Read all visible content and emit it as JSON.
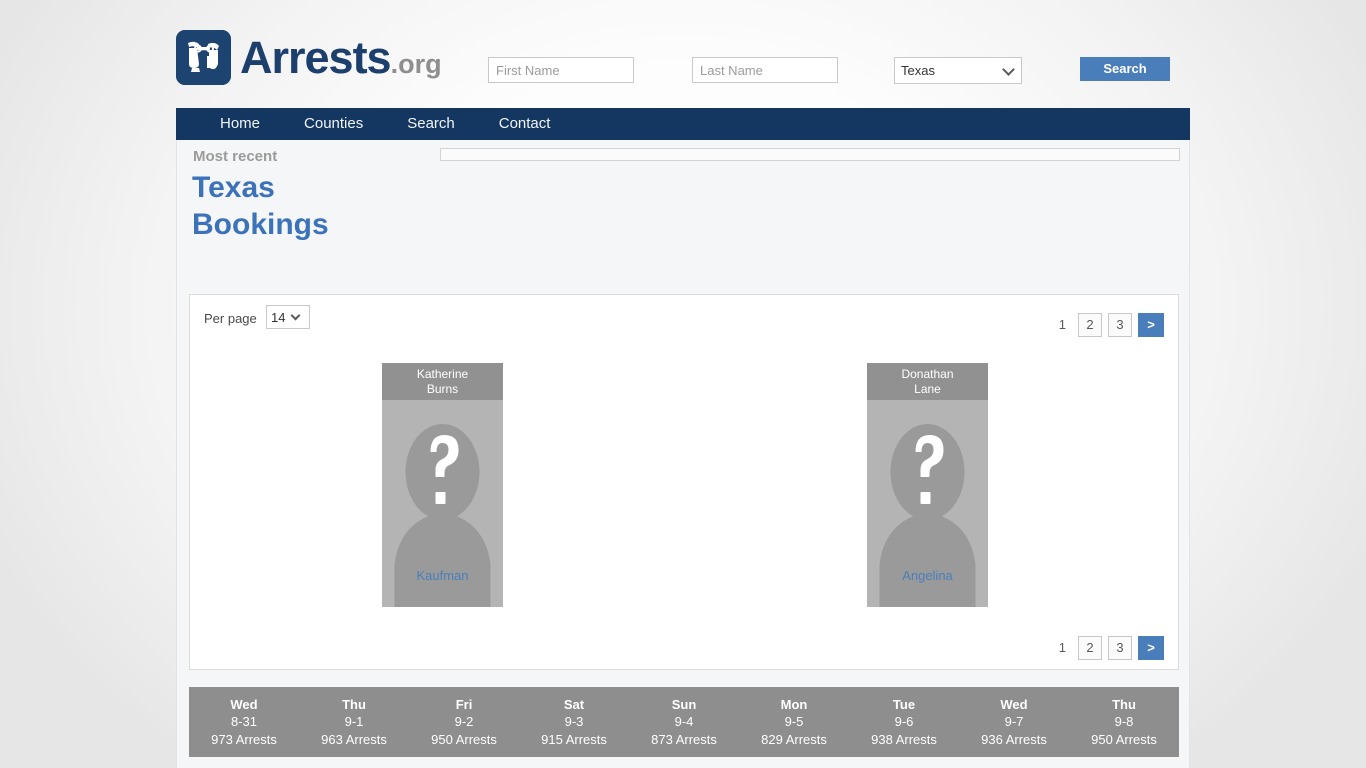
{
  "site": {
    "logo_text": "Arrests",
    "logo_suffix": ".org",
    "logo_icon": "handcuffs-icon"
  },
  "search": {
    "first_name_placeholder": "First Name",
    "first_name_value": "",
    "last_name_placeholder": "Last Name",
    "last_name_value": "",
    "state_selected": "Texas",
    "state_options": [
      "Texas"
    ],
    "search_label": "Search"
  },
  "nav": {
    "items": [
      {
        "label": "Home"
      },
      {
        "label": "Counties"
      },
      {
        "label": "Search"
      },
      {
        "label": "Contact"
      }
    ]
  },
  "heading": {
    "eyebrow": "Most recent",
    "title_line1": "Texas",
    "title_line2": "Bookings"
  },
  "toolbar": {
    "per_page_label": "Per page",
    "per_page_value": "14",
    "per_page_options": [
      "14"
    ]
  },
  "pagination": {
    "current": "1",
    "pages": [
      "2",
      "3"
    ],
    "next_label": ">"
  },
  "results": {
    "cards": [
      {
        "first_name": "Katherine",
        "last_name": "Burns",
        "county": "Kaufman",
        "photo": "no-photo-silhouette"
      },
      {
        "first_name": "Donathan",
        "last_name": "Lane",
        "county": "Angelina",
        "photo": "no-photo-silhouette"
      }
    ]
  },
  "calendar": {
    "days": [
      {
        "dow": "Wed",
        "date": "8-31",
        "count": "973 Arrests"
      },
      {
        "dow": "Thu",
        "date": "9-1",
        "count": "963 Arrests"
      },
      {
        "dow": "Fri",
        "date": "9-2",
        "count": "950 Arrests"
      },
      {
        "dow": "Sat",
        "date": "9-3",
        "count": "915 Arrests"
      },
      {
        "dow": "Sun",
        "date": "9-4",
        "count": "873 Arrests"
      },
      {
        "dow": "Mon",
        "date": "9-5",
        "count": "829 Arrests"
      },
      {
        "dow": "Tue",
        "date": "9-6",
        "count": "938 Arrests"
      },
      {
        "dow": "Wed",
        "date": "9-7",
        "count": "936 Arrests"
      },
      {
        "dow": "Thu",
        "date": "9-8",
        "count": "950 Arrests"
      }
    ]
  },
  "colors": {
    "brand_navy": "#143761",
    "link_blue": "#4a7ebb",
    "title_blue": "#3c72b9",
    "card_gray": "#a8a8a8",
    "strip_gray": "#8e8e8e"
  }
}
